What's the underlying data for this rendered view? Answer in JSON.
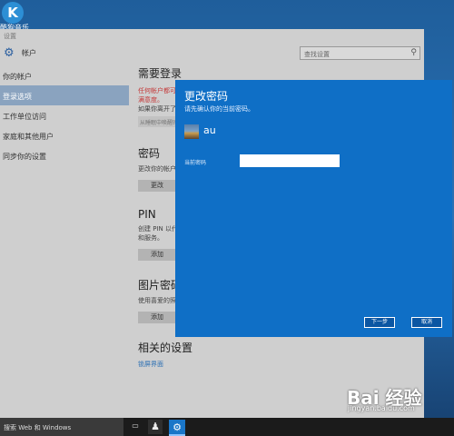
{
  "desktop": {
    "icon_letter": "K",
    "icon_label": "酷狗音乐"
  },
  "settings": {
    "window_title": "设置",
    "header_title": "帐户",
    "search_placeholder": "查找设置",
    "sidebar": [
      {
        "label": "你的帐户",
        "active": false
      },
      {
        "label": "登录选项",
        "active": true
      },
      {
        "label": "工作单位访问",
        "active": false
      },
      {
        "label": "家庭和其他用户",
        "active": false
      },
      {
        "label": "同步你的设置",
        "active": false
      }
    ],
    "require_signin": {
      "heading": "需要登录",
      "warning_line1": "任何帐户都可以使用，",
      "warning_line2": "满意度。",
      "question": "如果你离开了电脑，",
      "dropdown_value": "从睡眠中唤醒时"
    },
    "password": {
      "heading": "密码",
      "desc": "更改你的帐户密码",
      "button": "更改"
    },
    "pin": {
      "heading": "PIN",
      "desc_line1": "创建 PIN 以代",
      "desc_line2": "和服务。",
      "button": "添加"
    },
    "picture_password": {
      "heading": "图片密码",
      "desc": "使用喜爱的照片",
      "button": "添加"
    },
    "related": {
      "heading": "相关的设置",
      "link": "锁屏界面"
    }
  },
  "dialog": {
    "title": "更改密码",
    "subtitle": "请先确认你的当前密码。",
    "username": "au",
    "field_label": "当前密码",
    "input_value": "",
    "next_button": "下一步",
    "cancel_button": "取消"
  },
  "taskbar": {
    "search_text": "搜索 Web 和 Windows"
  },
  "watermark": {
    "brand": "Bai 经验",
    "url": "jingyan.baidu.com"
  }
}
